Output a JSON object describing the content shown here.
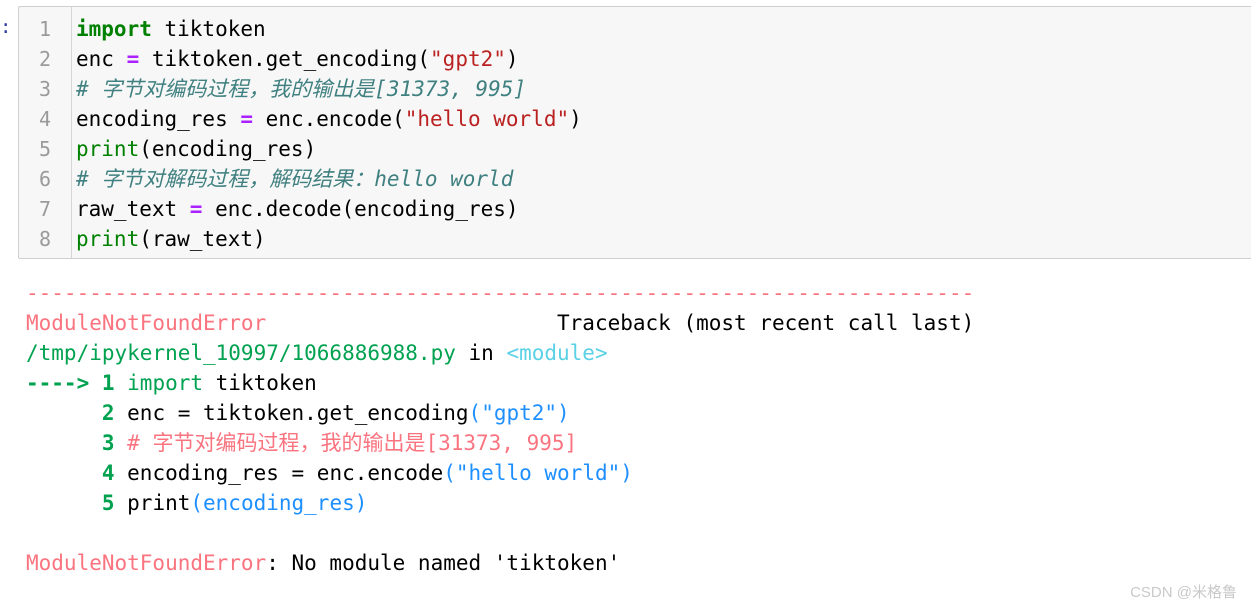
{
  "notebook": {
    "prompt_marker": ":",
    "input_cell": {
      "language": "python",
      "line_numbers": [
        "1",
        "2",
        "3",
        "4",
        "5",
        "6",
        "7",
        "8"
      ],
      "lines": [
        {
          "number": "1",
          "text": "import tiktoken",
          "tokens": [
            {
              "t": "import",
              "c": "t-kw"
            },
            {
              "t": " tiktoken",
              "c": "t-plain"
            }
          ]
        },
        {
          "number": "2",
          "text": "enc = tiktoken.get_encoding(\"gpt2\")",
          "tokens": [
            {
              "t": "enc ",
              "c": "t-plain"
            },
            {
              "t": "=",
              "c": "t-op"
            },
            {
              "t": " tiktoken.get_encoding(",
              "c": "t-plain"
            },
            {
              "t": "\"gpt2\"",
              "c": "t-str"
            },
            {
              "t": ")",
              "c": "t-plain"
            }
          ]
        },
        {
          "number": "3",
          "text": "# 字节对编码过程，我的输出是[31373, 995]",
          "tokens": [
            {
              "t": "# 字节对编码过程，我的输出是[31373, 995]",
              "c": "t-cmt"
            }
          ]
        },
        {
          "number": "4",
          "text": "encoding_res = enc.encode(\"hello world\")",
          "tokens": [
            {
              "t": "encoding_res ",
              "c": "t-plain"
            },
            {
              "t": "=",
              "c": "t-op"
            },
            {
              "t": " enc.encode(",
              "c": "t-plain"
            },
            {
              "t": "\"hello world\"",
              "c": "t-str"
            },
            {
              "t": ")",
              "c": "t-plain"
            }
          ]
        },
        {
          "number": "5",
          "text": "print(encoding_res)",
          "tokens": [
            {
              "t": "print",
              "c": "t-builtin"
            },
            {
              "t": "(encoding_res)",
              "c": "t-plain"
            }
          ]
        },
        {
          "number": "6",
          "text": "# 字节对解码过程，解码结果：hello world",
          "tokens": [
            {
              "t": "# 字节对解码过程，解码结果：hello world",
              "c": "t-cmt"
            }
          ]
        },
        {
          "number": "7",
          "text": "raw_text = enc.decode(encoding_res)",
          "tokens": [
            {
              "t": "raw_text ",
              "c": "t-plain"
            },
            {
              "t": "=",
              "c": "t-op"
            },
            {
              "t": " enc.decode(encoding_res)",
              "c": "t-plain"
            }
          ]
        },
        {
          "number": "8",
          "text": "print(raw_text)",
          "tokens": [
            {
              "t": "print",
              "c": "t-builtin"
            },
            {
              "t": "(raw_text)",
              "c": "t-plain"
            }
          ]
        }
      ]
    },
    "output_traceback": {
      "separator": "---------------------------------------------------------------------------",
      "exception_name": "ModuleNotFoundError",
      "traceback_header": "Traceback (most recent call last)",
      "frame_file": "/tmp/ipykernel_10997/1066886988.py",
      "frame_in": " in ",
      "frame_scope": "<module>",
      "lines": [
        {
          "marker": "----> ",
          "number": "1",
          "text": "import tiktoken",
          "tokens": [
            {
              "t": "import",
              "c": "tb-kw"
            },
            {
              "t": " tiktoken",
              "c": "tb-plain"
            }
          ]
        },
        {
          "marker": "      ",
          "number": "2",
          "text": "enc = tiktoken.get_encoding(\"gpt2\")",
          "tokens": [
            {
              "t": "enc = tiktoken.get_encoding",
              "c": "tb-plain"
            },
            {
              "t": "(",
              "c": "tb-punct"
            },
            {
              "t": "\"gpt2\"",
              "c": "tb-str"
            },
            {
              "t": ")",
              "c": "tb-punct"
            }
          ]
        },
        {
          "marker": "      ",
          "number": "3",
          "text": "# 字节对编码过程，我的输出是[31373, 995]",
          "tokens": [
            {
              "t": "# 字节对编码过程，我的输出是",
              "c": "tb-cmt"
            },
            {
              "t": "[31373, 995]",
              "c": "tb-num"
            }
          ]
        },
        {
          "marker": "      ",
          "number": "4",
          "text": "encoding_res = enc.encode(\"hello world\")",
          "tokens": [
            {
              "t": "encoding_res = enc.encode",
              "c": "tb-plain"
            },
            {
              "t": "(",
              "c": "tb-punct"
            },
            {
              "t": "\"hello world\"",
              "c": "tb-str"
            },
            {
              "t": ")",
              "c": "tb-punct"
            }
          ]
        },
        {
          "marker": "      ",
          "number": "5",
          "text": "print(encoding_res)",
          "tokens": [
            {
              "t": "print",
              "c": "tb-plain"
            },
            {
              "t": "(encoding_res)",
              "c": "tb-punct"
            }
          ]
        }
      ],
      "final_error_name": "ModuleNotFoundError",
      "final_error_message": ": No module named 'tiktoken'"
    }
  },
  "watermark": "CSDN @米格鲁",
  "colors": {
    "cell_background": "#f7f7f7",
    "cell_border": "#cfcfcf",
    "prompt_blue": "#303f9f",
    "error_salmon": "#fa7480",
    "path_green": "#00a250",
    "scope_cyan": "#5ad1e6",
    "string_blue": "#1e8fff",
    "code_string_red": "#ba2121",
    "code_keyword_green": "#008000",
    "code_operator_purple": "#aa22ff",
    "code_comment_teal": "#408080",
    "watermark_gray": "#c9c9c9"
  }
}
